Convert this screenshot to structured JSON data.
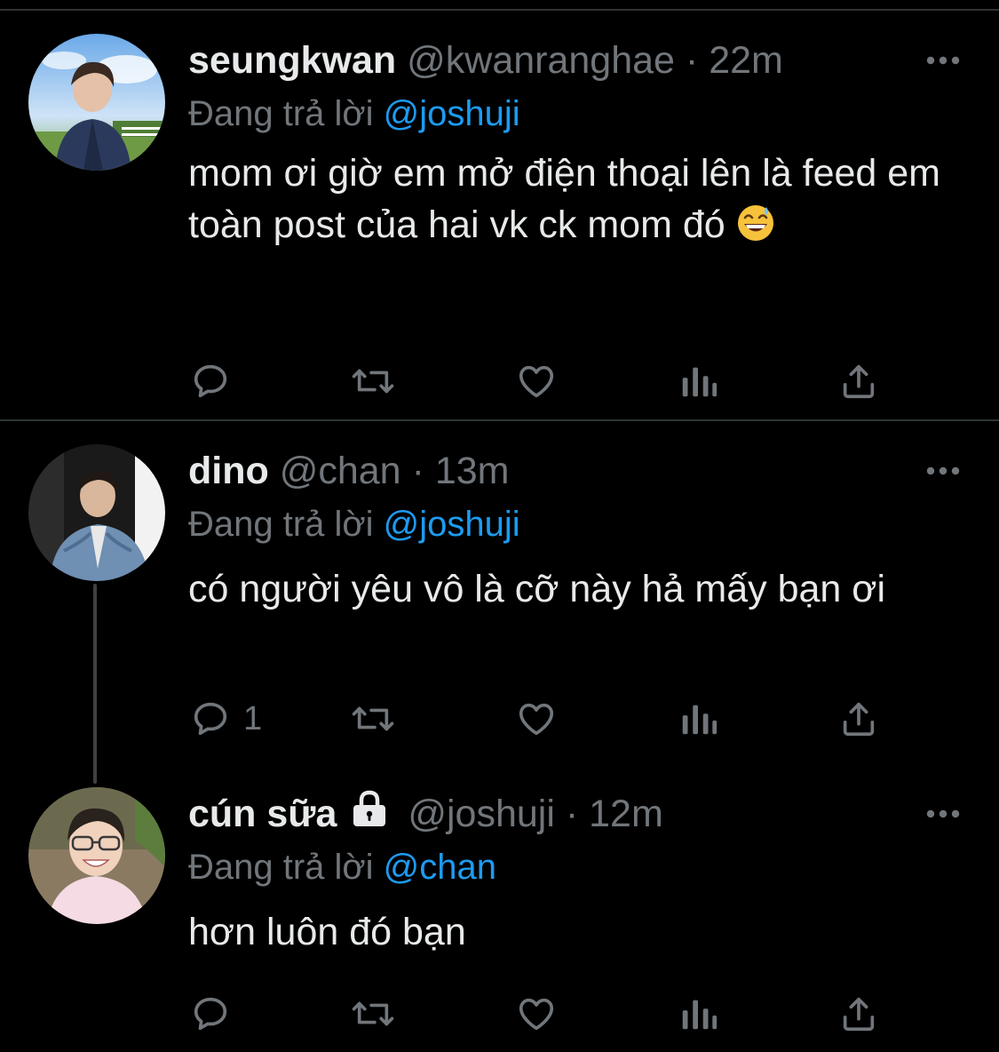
{
  "colors": {
    "background": "#000000",
    "text": "#e7e9ea",
    "secondary": "#71767b",
    "link": "#1d9bf0",
    "divider": "#2f3336"
  },
  "tweets": [
    {
      "name": "seungkwan",
      "handle": "@kwanranghae",
      "separator": "·",
      "time": "22m",
      "reply_prefix": "Đang trả lời",
      "reply_to": "@joshuji",
      "text": "mom ơi giờ em mở điện thoại lên là feed em toàn post của hai vk ck mom đó",
      "emoji": "grinning-face-with-sweat",
      "protected": false,
      "reply_count": ""
    },
    {
      "name": "dino",
      "handle": "@chan",
      "separator": "·",
      "time": "13m",
      "reply_prefix": "Đang trả lời",
      "reply_to": "@joshuji",
      "text": "có người yêu vô là cỡ này hả mấy bạn ơi",
      "protected": false,
      "reply_count": "1"
    },
    {
      "name": "cún sữa",
      "handle": "@joshuji",
      "separator": "·",
      "time": "12m",
      "reply_prefix": "Đang trả lời",
      "reply_to": "@chan",
      "text": "hơn luôn đó bạn",
      "protected": true,
      "reply_count": ""
    }
  ],
  "icons": {
    "reply": "reply-icon",
    "retweet": "retweet-icon",
    "like": "like-icon",
    "views": "views-icon",
    "share": "share-icon",
    "more": "more-icon",
    "lock": "lock-icon"
  }
}
